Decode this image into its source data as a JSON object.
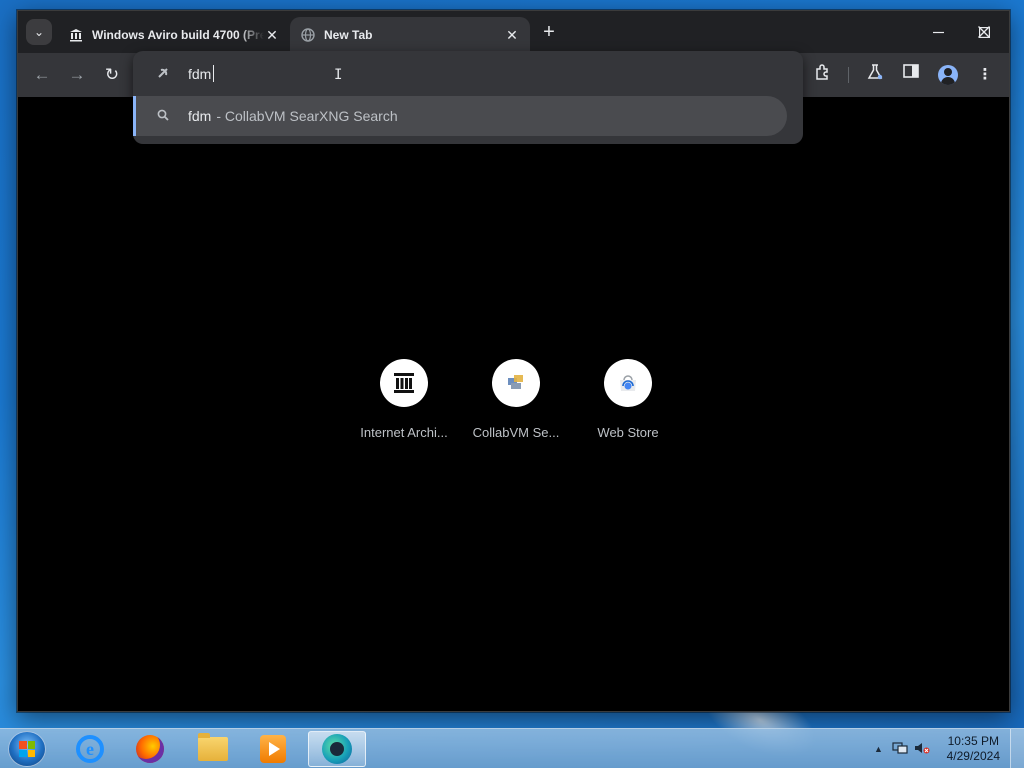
{
  "tabs": [
    {
      "title": "Windows Aviro build 4700 (Pre",
      "favicon": "museum-icon",
      "close": "✕"
    },
    {
      "title": "New Tab",
      "favicon": "globe-icon",
      "close": "✕"
    }
  ],
  "tab_search": "⌄",
  "new_tab": "+",
  "window_controls": {
    "minimize": "—",
    "maximize": "☐",
    "close": "✕"
  },
  "toolbar": {
    "back": "←",
    "forward": "→",
    "reload": "↻"
  },
  "omnibox": {
    "value": "fdm",
    "suggestion": {
      "text": "fdm",
      "description": "- CollabVM SearXNG Search",
      "icon": "search-icon"
    }
  },
  "toolbar_right": {
    "extensions": "extensions-icon",
    "labs": "flask-icon",
    "side_panel": "side-panel-icon",
    "profile": "profile-icon",
    "menu": "⋮"
  },
  "shortcuts": [
    {
      "label": "Internet Archi...",
      "icon": "museum-icon"
    },
    {
      "label": "CollabVM Se...",
      "icon": "collabvm-icon"
    },
    {
      "label": "Web Store",
      "icon": "web-store-icon"
    }
  ],
  "taskbar": {
    "apps": [
      "internet-explorer",
      "firefox",
      "file-explorer",
      "media-player",
      "edge"
    ],
    "clock": {
      "time": "10:35 PM",
      "date": "4/29/2024"
    }
  },
  "colors": {
    "accent": "#8ab4f8",
    "toolbar": "#35363a",
    "tabstrip": "#202124",
    "content_bg": "#000000"
  }
}
